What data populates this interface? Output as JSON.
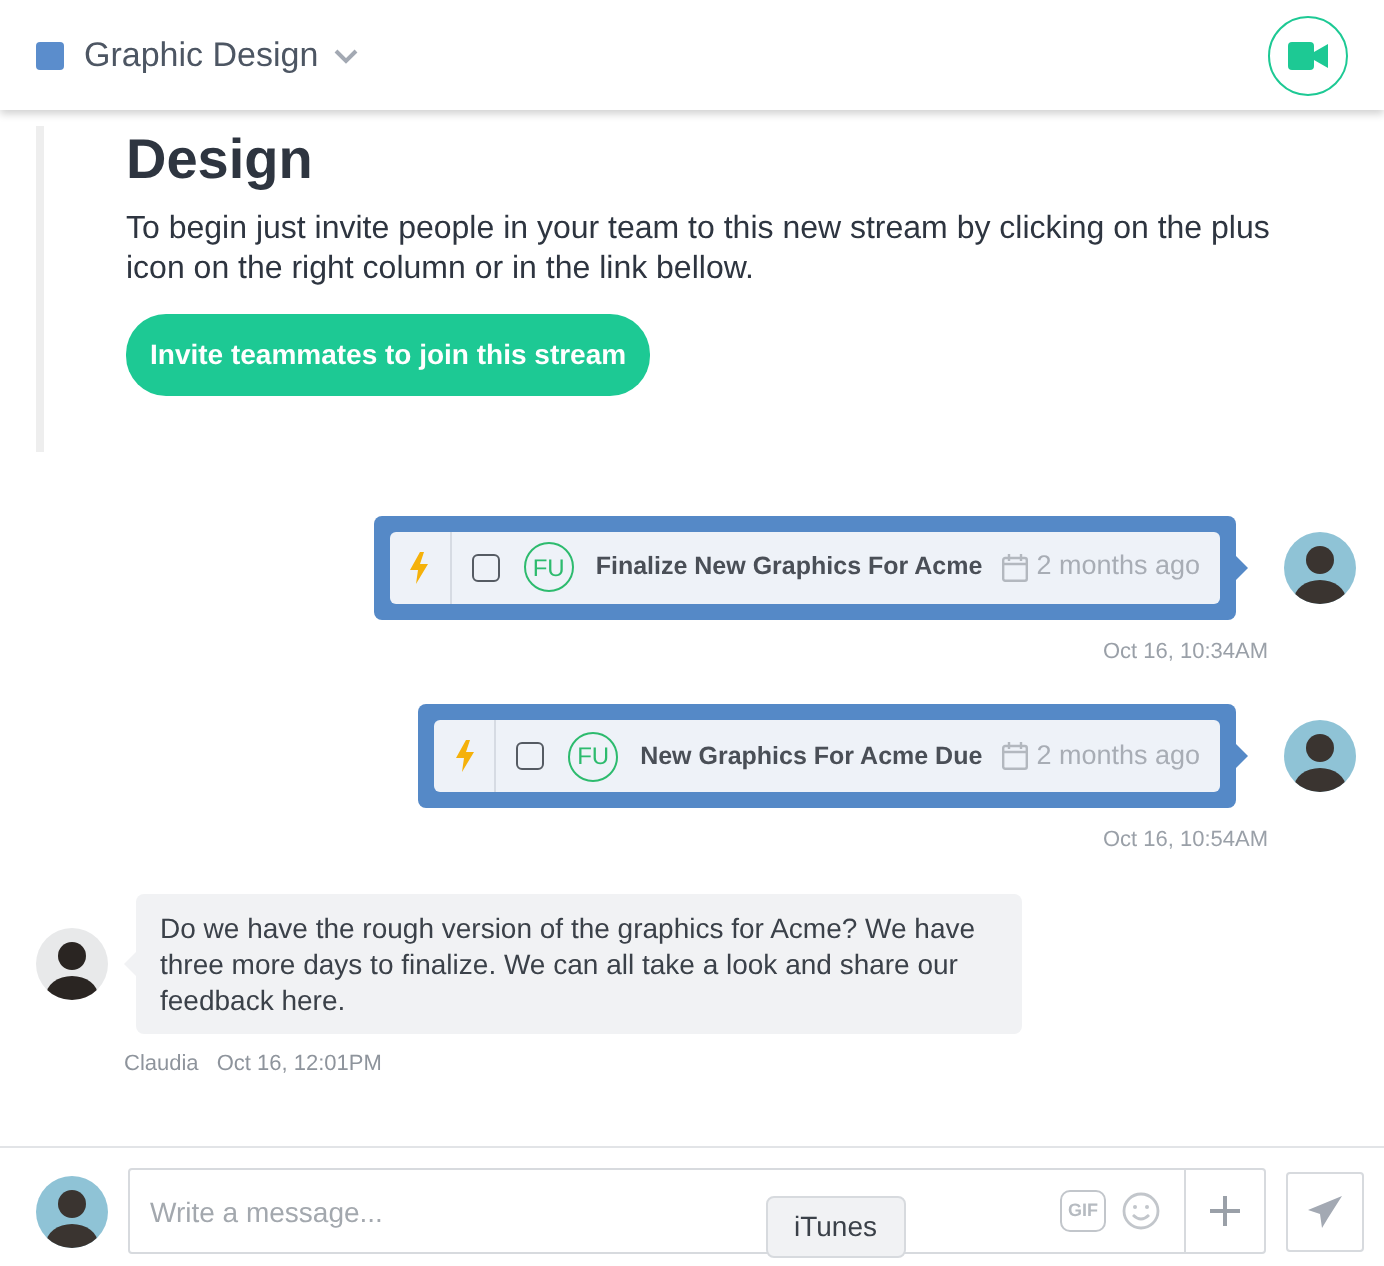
{
  "stream": {
    "name": "Graphic Design"
  },
  "intro": {
    "heading": "Design",
    "text": "To begin just invite people in your team to this new stream by clicking on the plus icon on the right column or in the link bellow.",
    "button": "Invite teammates to join this stream"
  },
  "messages": [
    {
      "kind": "task",
      "initials": "FU",
      "checked": false,
      "title": "Finalize New Graphics For Acme",
      "due": "2 months ago",
      "time": "Oct 16, 10:34AM"
    },
    {
      "kind": "task",
      "initials": "FU",
      "checked": false,
      "title": "New Graphics For Acme Due",
      "due": "2 months ago",
      "time": "Oct 16, 10:54AM"
    },
    {
      "kind": "text",
      "author": "Claudia",
      "text": "Do we have the rough version of the graphics for Acme? We have three more days to finalize. We can all take a look and share our feedback here.",
      "time": "Oct 16, 12:01PM"
    }
  ],
  "composer": {
    "placeholder": "Write a message...",
    "gif": "GIF"
  },
  "tooltip": "iTunes"
}
